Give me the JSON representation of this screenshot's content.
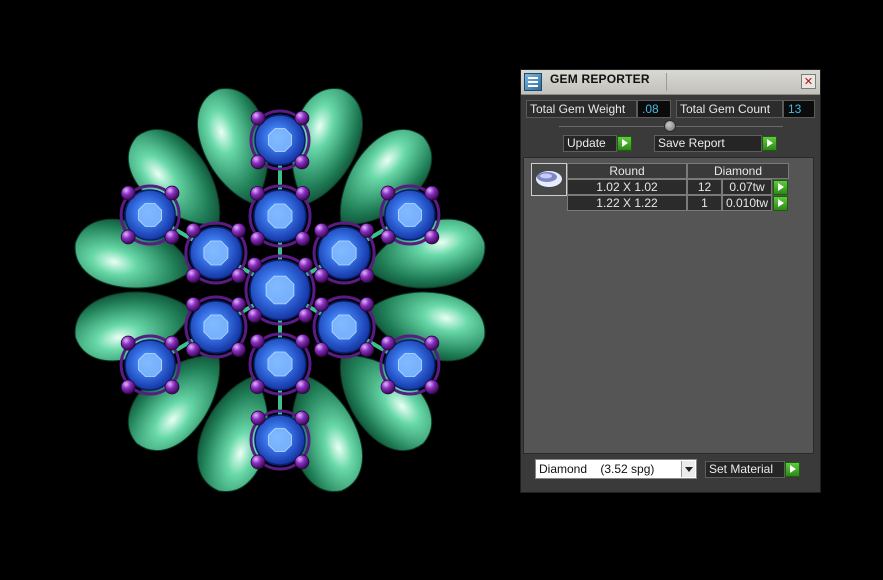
{
  "window": {
    "title": "GEM REPORTER",
    "close_icon": "close-icon"
  },
  "summary": {
    "weight_label": "Total Gem Weight",
    "weight_value": ".08",
    "count_label": "Total Gem Count",
    "count_value": "13"
  },
  "actions": {
    "update_label": "Update",
    "save_report_label": "Save Report"
  },
  "gem_table": {
    "shape": "Round",
    "material": "Diamond",
    "rows": [
      {
        "size": "1.02 X 1.02",
        "count": "12",
        "weight": "0.07tw"
      },
      {
        "size": "1.22 X 1.22",
        "count": "1",
        "weight": "0.010tw"
      }
    ]
  },
  "material_select": {
    "value": "Diamond    (3.52 spg)"
  },
  "set_material_label": "Set Material",
  "colors": {
    "accent_value": "#46b9e6",
    "play_green": "#3aa21f",
    "gem_blue": "#1f4fd6",
    "prong_purple": "#7a1f9e",
    "metal_green": "#2fa37a"
  }
}
